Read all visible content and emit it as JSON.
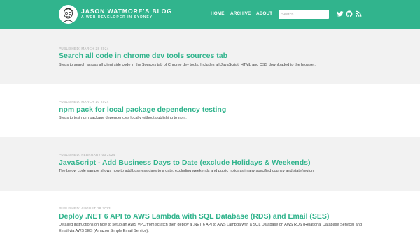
{
  "header": {
    "title": "JASON WATMORE'S BLOG",
    "subtitle": "A WEB DEVELOPER IN SYDNEY",
    "nav": [
      "HOME",
      "ARCHIVE",
      "ABOUT"
    ],
    "search_placeholder": "Search...",
    "background": "#31b48d",
    "social_icons": [
      "twitter-icon",
      "github-icon",
      "rss-icon"
    ]
  },
  "posts": [
    {
      "meta": "PUBLISHED: MARCH 28 2024",
      "title": "Search all code in chrome dev tools sources tab",
      "summary": "Steps to search across all client side code in the Sources tab of Chrome dev tools. Includes all JavaScript, HTML and CSS downloaded to the browser."
    },
    {
      "meta": "PUBLISHED: MARCH 10 2024",
      "title": "npm pack for local package dependency testing",
      "summary": "Steps to test npm package dependencies locally without publishing to npm."
    },
    {
      "meta": "PUBLISHED: FEBRUARY 03 2024",
      "title": "JavaScript - Add Business Days to Date (exclude Holidays & Weekends)",
      "summary": "The below code sample shows how to add business days to a date, excluding weekends and public holidays in any specified country and state/region."
    },
    {
      "meta": "PUBLISHED: AUGUST 18 2023",
      "title": "Deploy .NET 6 API to AWS Lambda with SQL Database (RDS) and Email (SES)",
      "summary": "Detailed instructions on how to setup an AWS VPC from scratch then deploy a .NET 6 API to AWS Lambda with a SQL Database on AWS RDS (Relational Database Service) and Email via AWS SES (Amazon Simple Email Service)."
    }
  ]
}
